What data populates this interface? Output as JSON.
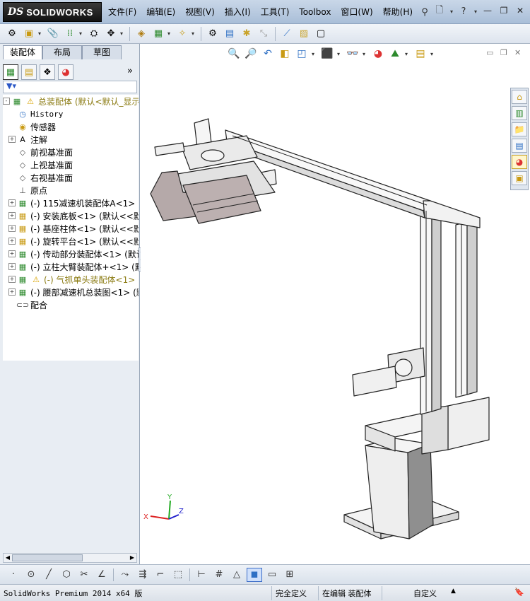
{
  "app": {
    "logo_ds": "DS",
    "logo_name": "SOLIDWORKS"
  },
  "menu": [
    "文件(F)",
    "编辑(E)",
    "视图(V)",
    "插入(I)",
    "工具(T)",
    "Toolbox",
    "窗口(W)",
    "帮助(H)"
  ],
  "panel_tabs": [
    "装配体",
    "布局",
    "草图"
  ],
  "tree": [
    {
      "label": "总装配体  (默认<默认_显示状",
      "icon": "assembly-icon",
      "warn": true,
      "expand": "-"
    },
    {
      "label": "History",
      "icon": "history-icon",
      "mono": true,
      "expand": ""
    },
    {
      "label": "传感器",
      "icon": "sensor-icon",
      "expand": ""
    },
    {
      "label": "注解",
      "icon": "annotation-icon",
      "expand": "+"
    },
    {
      "label": "前视基准面",
      "icon": "plane-icon",
      "expand": ""
    },
    {
      "label": "上视基准面",
      "icon": "plane-icon",
      "expand": ""
    },
    {
      "label": "右视基准面",
      "icon": "plane-icon",
      "expand": ""
    },
    {
      "label": "原点",
      "icon": "origin-icon",
      "expand": ""
    },
    {
      "label": "(-) 115减速机装配体A<1> (默",
      "icon": "assembly-icon",
      "expand": "+"
    },
    {
      "label": "(-) 安装底板<1> (默认<<默认",
      "icon": "part-icon",
      "expand": "+"
    },
    {
      "label": "(-) 基座柱体<1> (默认<<默认",
      "icon": "part-icon",
      "expand": "+"
    },
    {
      "label": "(-) 旋转平台<1> (默认<<默认",
      "icon": "part-icon",
      "expand": "+"
    },
    {
      "label": "(-) 传动部分装配体<1> (默认",
      "icon": "assembly-icon",
      "expand": "+"
    },
    {
      "label": "(-) 立柱大臂装配体+<1> (默",
      "icon": "assembly-icon",
      "expand": "+"
    },
    {
      "label": "(-) 气抓单头装配体<1>",
      "icon": "assembly-icon",
      "warn": true,
      "expand": "+"
    },
    {
      "label": "(-) 腰部减速机总装图<1> (默",
      "icon": "assembly-icon",
      "expand": "+"
    },
    {
      "label": "配合",
      "icon": "mates-icon",
      "expand": ""
    }
  ],
  "axis": {
    "x": "X",
    "y": "Y",
    "z": "Z"
  },
  "status": {
    "app": "SolidWorks Premium 2014 x64 版",
    "defined": "完全定义",
    "editing": "在编辑 装配体",
    "custom": "自定义"
  },
  "colors": {
    "title_bg": "#b7c8de",
    "panel_bg": "#e8edf3",
    "warn_text": "#8a7a10",
    "model_fill": "#f4f4f4",
    "model_stroke": "#222222"
  }
}
